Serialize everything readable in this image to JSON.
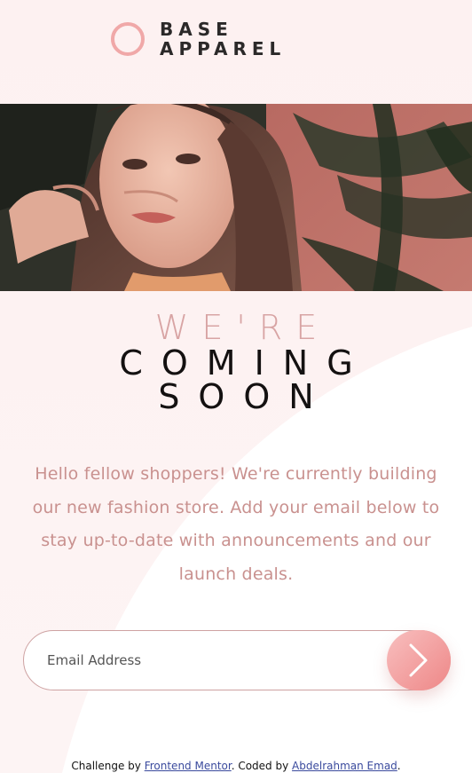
{
  "brand": {
    "line1": "BASE",
    "line2": "APPAREL",
    "accent_color": "#f0a8a8"
  },
  "hero": {
    "image_alt": "Woman with long brown hair touching her hair in front of a plant"
  },
  "heading": {
    "light": "WE'RE",
    "dark_line1": "COMING",
    "dark_line2": "SOON"
  },
  "intro": {
    "text": "Hello fellow shoppers! We're currently building our new fashion store. Add your email below to stay up-to-date with announcements and our launch deals."
  },
  "form": {
    "email_placeholder": "Email Address",
    "submit_icon": "arrow-right-icon",
    "button_gradient": [
      "#f8bfbf",
      "#ee8787"
    ]
  },
  "footer": {
    "prefix": "Challenge by ",
    "link1": "Frontend Mentor",
    "middle": ". Coded by ",
    "link2": "Abdelrahman Emad",
    "suffix": "."
  },
  "colors": {
    "text_pink": "#c9918f",
    "heading_light": "#d8a4a4",
    "heading_dark": "#141111",
    "link": "#3a4a9d"
  }
}
